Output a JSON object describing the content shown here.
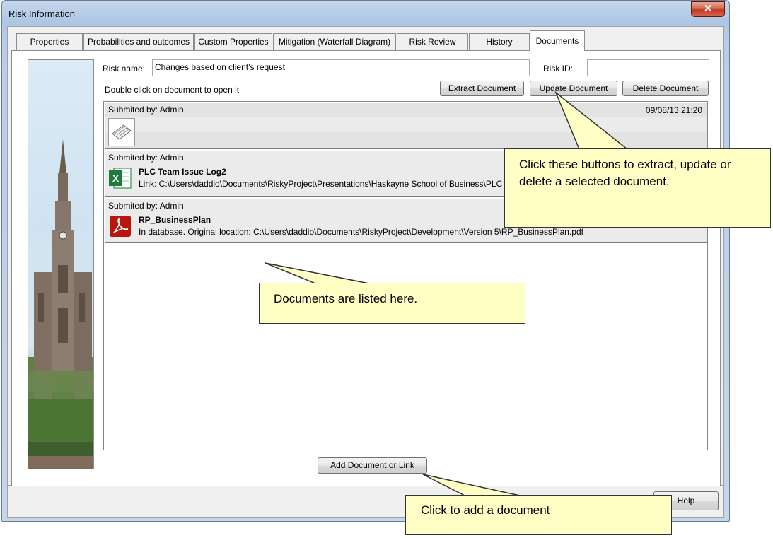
{
  "window": {
    "title": "Risk Information",
    "close_glyph": "✕"
  },
  "tabs": [
    {
      "label": "Properties",
      "active": false
    },
    {
      "label": "Probabilities and outcomes",
      "active": false
    },
    {
      "label": "Custom Properties",
      "active": false
    },
    {
      "label": "Mitigation (Waterfall Diagram)",
      "active": false
    },
    {
      "label": "Risk Review",
      "active": false
    },
    {
      "label": "History",
      "active": false
    },
    {
      "label": "Documents",
      "active": true
    }
  ],
  "form": {
    "risk_name_label": "Risk name:",
    "risk_name_value": "Changes based on client’s request",
    "risk_id_label": "Risk ID:",
    "risk_id_value": "",
    "hint": "Double click on document to open it"
  },
  "buttons": {
    "extract": "Extract Document",
    "update": "Update Document",
    "delete": "Delete Document",
    "add": "Add Document or Link",
    "help": "Help"
  },
  "documents": [
    {
      "submitted": "Submited by: Admin",
      "date": "09/08/13 21:20",
      "name": "",
      "detail": "",
      "icon": "note-icon"
    },
    {
      "submitted": "Submited by: Admin",
      "date": "",
      "name": "PLC Team Issue Log2",
      "detail": "Link: C:\\Users\\daddio\\Documents\\RiskyProject\\Presentations\\Haskayne School of Business\\PLC",
      "icon": "excel-icon"
    },
    {
      "submitted": "Submited by: Admin",
      "date": "",
      "name": "RP_BusinessPlan",
      "detail": "In database. Original location: C:\\Users\\daddio\\Documents\\RiskyProject\\Development\\Version 5\\RP_BusinessPlan.pdf",
      "icon": "pdf-icon"
    }
  ],
  "callouts": {
    "buttons": "Click these buttons to extract, update or delete a selected document.",
    "list": "Documents are listed here.",
    "add": "Click to add a document"
  },
  "colors": {
    "callout_bg": "#ffffc5",
    "close_button": "#c1391f",
    "excel_green": "#1e7b3c",
    "pdf_red": "#b8150f"
  }
}
